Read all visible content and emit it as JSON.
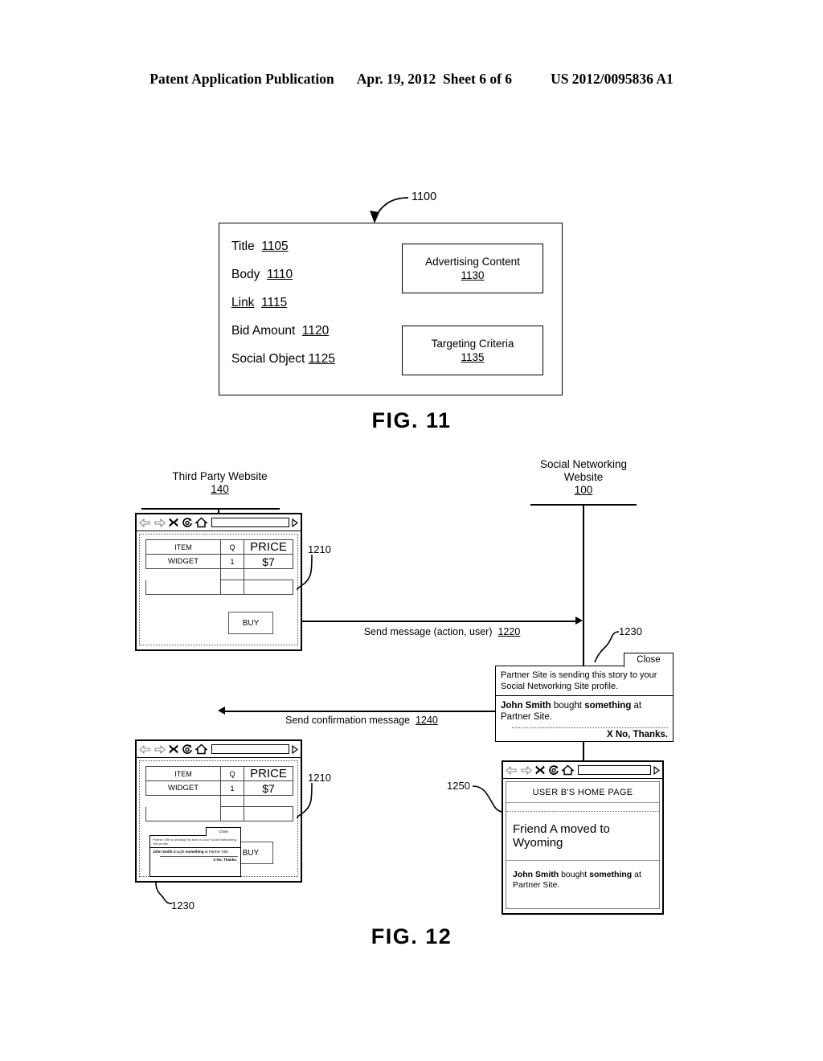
{
  "header": {
    "left": "Patent Application Publication",
    "date": "Apr. 19, 2012",
    "sheet": "Sheet 6 of 6",
    "pubno": "US 2012/0095836 A1"
  },
  "fig11": {
    "caption": "FIG. 11",
    "ref": "1100",
    "fields": [
      {
        "label": "Title",
        "ref": "1105"
      },
      {
        "label": "Body",
        "ref": "1110"
      },
      {
        "label": "Link",
        "ref": "1115",
        "label_underlined": true
      },
      {
        "label": "Bid Amount",
        "ref": "1120"
      },
      {
        "label": "Social Object",
        "ref": "1125"
      }
    ],
    "boxes": [
      {
        "title": "Advertising Content",
        "ref": "1130"
      },
      {
        "title": "Targeting Criteria",
        "ref": "1135"
      }
    ]
  },
  "fig12": {
    "caption": "FIG. 12",
    "lifelines": [
      {
        "name": "Third Party Website",
        "ref": "140"
      },
      {
        "name": "Social Networking Website",
        "line1": "Social Networking",
        "line2": "Website",
        "ref": "100"
      }
    ],
    "browser_toolbar": {
      "icons": [
        "back-arrow-icon",
        "forward-arrow-icon",
        "close-x-icon",
        "reload-icon",
        "home-icon"
      ],
      "address_value": ""
    },
    "cart": {
      "ref": "1210",
      "headers": [
        "ITEM",
        "Q",
        "PRICE"
      ],
      "rows": [
        [
          "WIDGET",
          "1",
          "$7"
        ]
      ],
      "buy_label": "BUY"
    },
    "messages": [
      {
        "text": "Send message (action, user)",
        "ref": "1220",
        "direction": "right"
      },
      {
        "text": "Send confirmation message",
        "ref": "1240",
        "direction": "left"
      }
    ],
    "dialog": {
      "ref": "1230",
      "close_label": "Close",
      "prompt_line1": "Partner Site is sending this story to your",
      "prompt_line2": "Social Networking Site profile.",
      "story_bold1": "John Smith",
      "story_mid": " bought ",
      "story_bold2": "something",
      "story_tail": " at Partner Site.",
      "decline_label": "X  No, Thanks."
    },
    "homepage": {
      "ref": "1250",
      "title": "USER B'S HOME PAGE",
      "story1": "Friend A moved to Wyoming",
      "story2_bold1": "John Smith",
      "story2_mid": " bought ",
      "story2_bold2": "something",
      "story2_tail": " at Partner Site."
    }
  }
}
